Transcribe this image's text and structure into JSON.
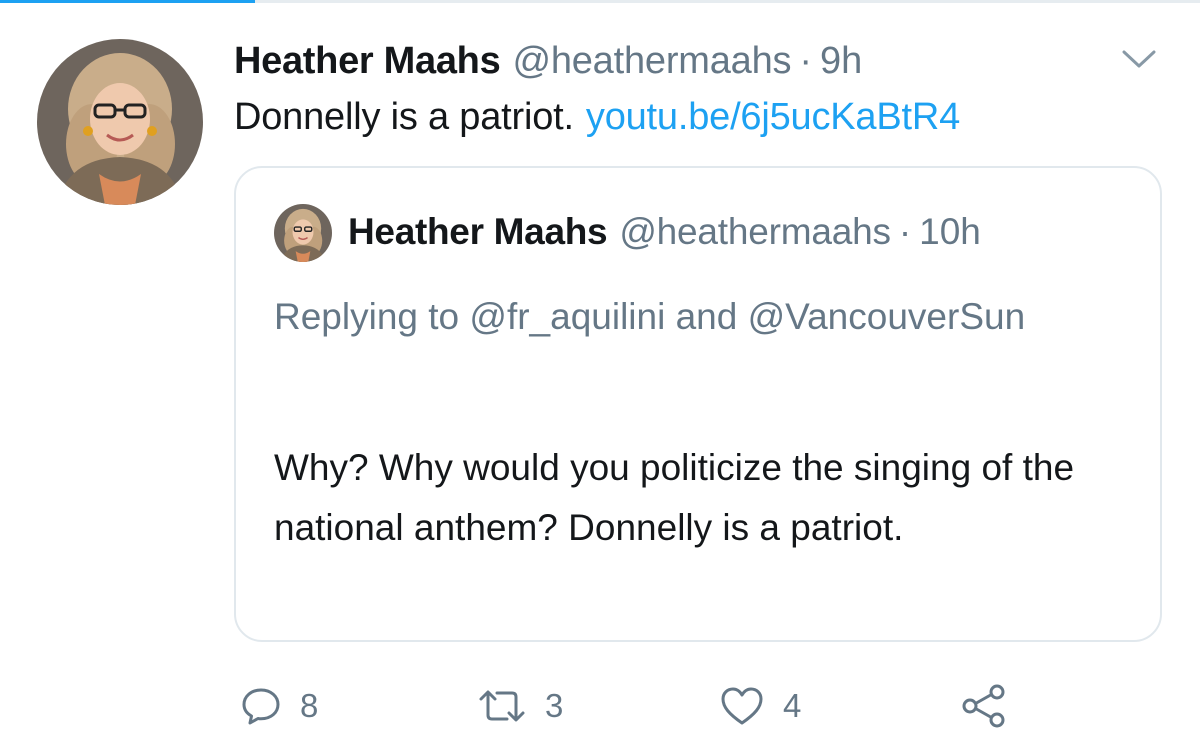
{
  "tweet": {
    "author_name": "Heather Maahs",
    "handle": "@heathermaahs",
    "separator": "·",
    "time": "9h",
    "text": "Donnelly is a patriot.",
    "link": "youtu.be/6j5ucKaBtR4",
    "menu_icon": "chevron-down-icon"
  },
  "quoted": {
    "author_name": "Heather Maahs",
    "handle": "@heathermaahs",
    "separator": "·",
    "time": "10h",
    "replying_to": "Replying to @fr_aquilini and @VancouverSun",
    "text": "Why? Why would you politicize the singing of the national anthem? Donnelly is a patriot."
  },
  "actions": {
    "reply": {
      "icon": "reply-icon",
      "count": "8"
    },
    "retweet": {
      "icon": "retweet-icon",
      "count": "3"
    },
    "like": {
      "icon": "heart-icon",
      "count": "4"
    },
    "share": {
      "icon": "share-icon"
    }
  },
  "colors": {
    "accent": "#1da1f2",
    "text": "#14171a",
    "secondary": "#657786",
    "border": "#e1e8ed"
  }
}
